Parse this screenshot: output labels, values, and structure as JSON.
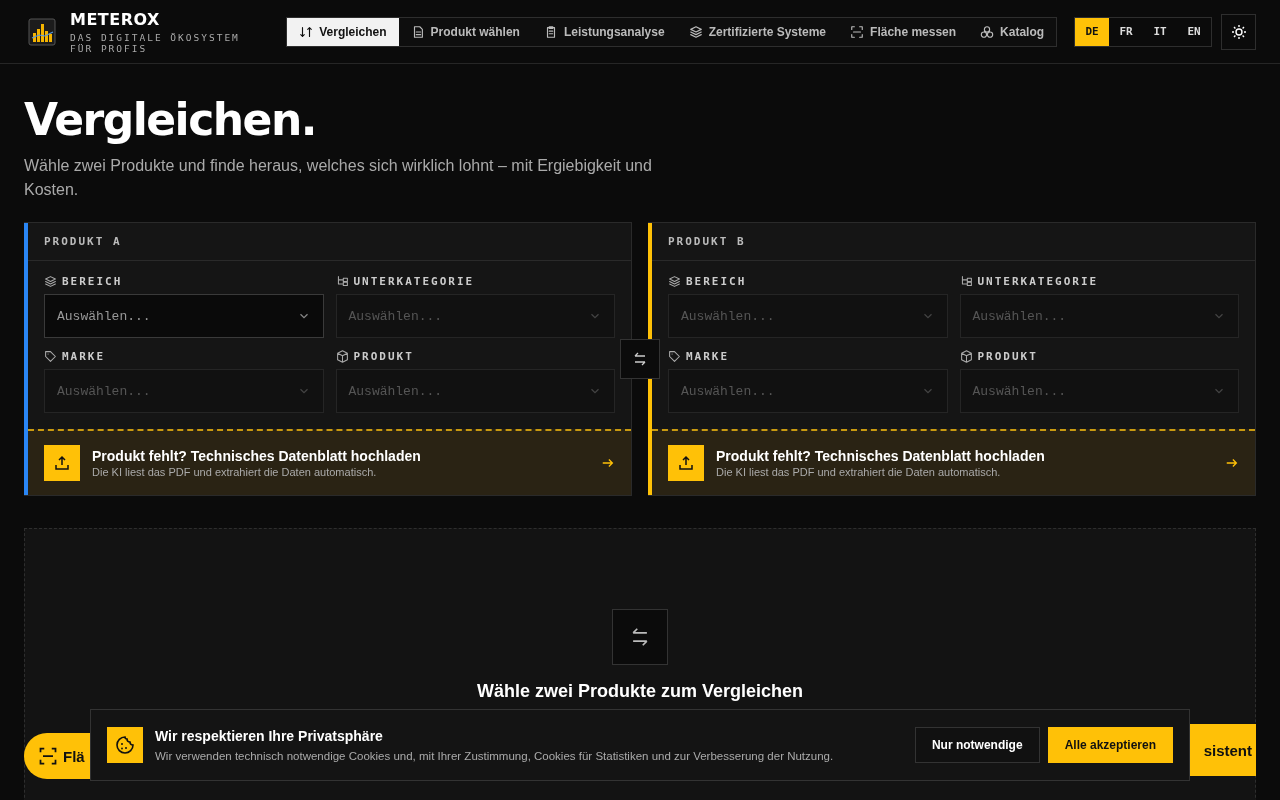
{
  "brand": {
    "name": "METEROX",
    "tagline": "DAS DIGITALE ÖKOSYSTEM FÜR PROFIS"
  },
  "nav": [
    {
      "label": "Vergleichen",
      "selected": true
    },
    {
      "label": "Produkt wählen",
      "selected": false
    },
    {
      "label": "Leistungsanalyse",
      "selected": false
    },
    {
      "label": "Zertifizierte Systeme",
      "selected": false
    },
    {
      "label": "Fläche messen",
      "selected": false
    },
    {
      "label": "Katalog",
      "selected": false
    }
  ],
  "languages": [
    {
      "label": "DE",
      "selected": true
    },
    {
      "label": "FR",
      "selected": false
    },
    {
      "label": "IT",
      "selected": false
    },
    {
      "label": "EN",
      "selected": false
    }
  ],
  "page": {
    "title": "Vergleichen.",
    "subtitle": "Wähle zwei Produkte und finde heraus, welches sich wirklich lohnt – mit Ergiebigkeit und Kosten."
  },
  "products": [
    {
      "label": "PRODUKT A",
      "color": "#2a86f5",
      "fields": [
        {
          "label": "BEREICH",
          "placeholder": "Auswählen...",
          "disabled": false
        },
        {
          "label": "UNTERKATEGORIE",
          "placeholder": "Auswählen...",
          "disabled": true
        },
        {
          "label": "MARKE",
          "placeholder": "Auswählen...",
          "disabled": true
        },
        {
          "label": "PRODUKT",
          "placeholder": "Auswählen...",
          "disabled": true
        }
      ],
      "upload": {
        "title": "Produkt fehlt? Technisches Datenblatt hochladen",
        "text": "Die KI liest das PDF und extrahiert die Daten automatisch."
      }
    },
    {
      "label": "PRODUKT B",
      "color": "#ffc107",
      "fields": [
        {
          "label": "BEREICH",
          "placeholder": "Auswählen...",
          "disabled": true
        },
        {
          "label": "UNTERKATEGORIE",
          "placeholder": "Auswählen...",
          "disabled": true
        },
        {
          "label": "MARKE",
          "placeholder": "Auswählen...",
          "disabled": true
        },
        {
          "label": "PRODUKT",
          "placeholder": "Auswählen...",
          "disabled": true
        }
      ],
      "upload": {
        "title": "Produkt fehlt? Technisches Datenblatt hochladen",
        "text": "Die KI liest das PDF und extrahiert die Daten automatisch."
      }
    }
  ],
  "empty": {
    "title": "Wähle zwei Produkte zum Vergleichen"
  },
  "fab_left": {
    "label": "Flä"
  },
  "fab_right": {
    "label": "sistent"
  },
  "cookie": {
    "title": "Wir respektieren Ihre Privatsphäre",
    "text": "Wir verwenden technisch notwendige Cookies und, mit Ihrer Zustimmung, Cookies für Statistiken und zur Verbesserung der Nutzung.",
    "buttons": [
      {
        "label": "Nur notwendige",
        "kind": "secondary"
      },
      {
        "label": "Alle akzeptieren",
        "kind": "primary"
      }
    ]
  }
}
